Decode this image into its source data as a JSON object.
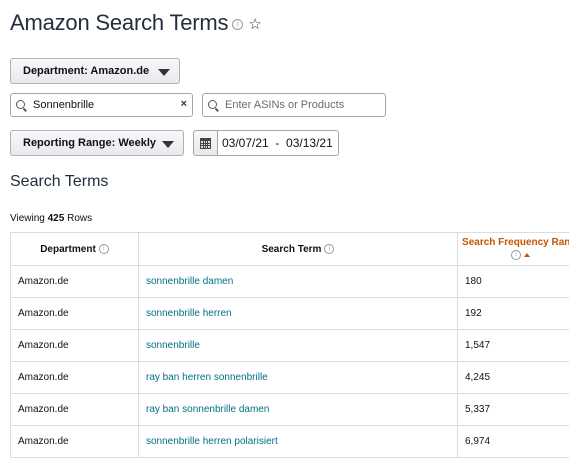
{
  "header": {
    "title": "Amazon Search Terms",
    "info_icon": "ⓘ",
    "star_icon": "☆"
  },
  "filters": {
    "department_label": "Department: Amazon.de",
    "search_value": "Sonnenbrille",
    "search_clear": "×",
    "asin_placeholder": "Enter ASINs or Products",
    "reporting_range_label": "Reporting Range: Weekly",
    "date_range": "03/07/21  -  03/13/21"
  },
  "section": {
    "title": "Search Terms",
    "viewing_prefix": "Viewing",
    "row_count": "425",
    "viewing_suffix": "Rows"
  },
  "table": {
    "columns": [
      "Department",
      "Search Term",
      "Search Frequency Rank"
    ],
    "sorted_column": "Search Frequency Rank",
    "rows": [
      {
        "department": "Amazon.de",
        "term": "sonnenbrille damen",
        "rank": "180"
      },
      {
        "department": "Amazon.de",
        "term": "sonnenbrille herren",
        "rank": "192"
      },
      {
        "department": "Amazon.de",
        "term": "sonnenbrille",
        "rank": "1,547"
      },
      {
        "department": "Amazon.de",
        "term": "ray ban herren sonnenbrille",
        "rank": "4,245"
      },
      {
        "department": "Amazon.de",
        "term": "ray ban sonnenbrille damen",
        "rank": "5,337"
      },
      {
        "department": "Amazon.de",
        "term": "sonnenbrille herren polarisiert",
        "rank": "6,974"
      }
    ]
  },
  "colors": {
    "link": "#007185",
    "sorted_header": "#c45500",
    "title": "#232f3e"
  }
}
